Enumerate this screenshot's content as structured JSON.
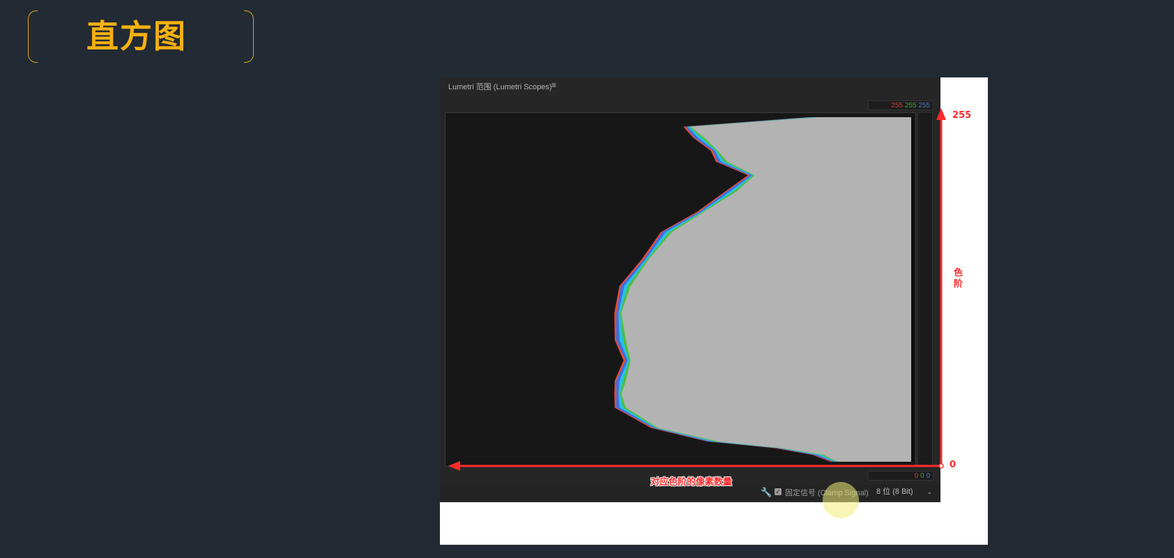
{
  "slide": {
    "title": "直方图"
  },
  "panel": {
    "header": "Lumetri 范围 (Lumetri Scopes)",
    "menu_icon": "hamburger-menu-icon",
    "top_readout": {
      "r": "255",
      "g": "255",
      "b": "255"
    },
    "bottom_readout": {
      "r": "0",
      "g": "0",
      "b": "0"
    },
    "footer": {
      "tool_icon": "wrench-icon",
      "clamp_checked": true,
      "clamp_label": "固定信号 (Clamp Signal)",
      "bit_depth": "8 位 (8 Bit)"
    }
  },
  "annotations": {
    "top_value": "255",
    "bottom_value": "0",
    "vertical_label_1": "色",
    "vertical_label_2": "阶",
    "horizontal_label": "对应色阶的像素数量"
  },
  "colors": {
    "background": "#222a34",
    "title": "#f5b10f",
    "bracket": "#e3a51a",
    "annotation": "#ff2a2a",
    "histogram_luma": "#b3b3b3",
    "histogram_red": "#f24a2e",
    "histogram_yellow": "#f2c52e",
    "histogram_cyan": "#27c0e8",
    "histogram_blue": "#3f6fe0",
    "histogram_green": "#4fbf3a",
    "histogram_magenta": "#e23fd0"
  },
  "chart_data": {
    "type": "area",
    "orientation": "horizontal",
    "ylim": [
      0,
      255
    ],
    "levels": [
      0,
      5,
      10,
      15,
      25,
      40,
      50,
      60,
      75,
      90,
      110,
      130,
      150,
      170,
      185,
      200,
      212,
      222,
      230,
      240,
      248,
      255
    ],
    "series": [
      {
        "color": "#b3b3b3",
        "values": [
          0.16,
          0.19,
          0.28,
          0.42,
          0.55,
          0.62,
          0.63,
          0.62,
          0.61,
          0.62,
          0.63,
          0.61,
          0.57,
          0.52,
          0.45,
          0.38,
          0.34,
          0.4,
          0.42,
          0.45,
          0.48,
          0.2
        ]
      }
    ]
  }
}
